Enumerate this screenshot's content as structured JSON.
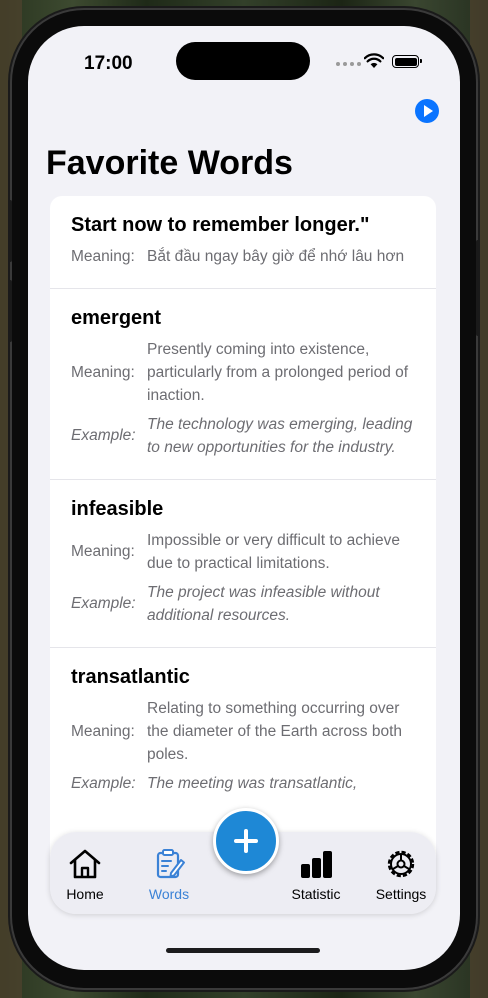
{
  "status_bar": {
    "time": "17:00"
  },
  "page": {
    "title": "Favorite Words"
  },
  "labels": {
    "meaning": "Meaning:",
    "example": "Example:"
  },
  "entries": [
    {
      "word": "Start now to remember longer.\"",
      "meaning": "Bắt đầu ngay bây giờ để nhớ lâu hơn"
    },
    {
      "word": "emergent",
      "meaning": "Presently coming into existence, particularly from a prolonged period of inaction.",
      "example": "The technology was emerging, leading to new opportunities for the industry."
    },
    {
      "word": "infeasible",
      "meaning": "Impossible or very difficult to achieve due to practical limitations.",
      "example": "The project was infeasible without additional resources."
    },
    {
      "word": "transatlantic",
      "meaning": "Relating to something occurring over the diameter of the Earth across both poles.",
      "example": "The meeting was transatlantic,"
    }
  ],
  "tabbar": {
    "home": "Home",
    "words": "Words",
    "statistic": "Statistic",
    "settings": "Settings",
    "active": "words"
  },
  "colors": {
    "accent": "#1e88d6",
    "active_tab": "#3b82d6",
    "play_button": "#0a74ff"
  },
  "icons": {
    "play": "play-circle-icon",
    "add": "plus-icon",
    "home": "house-icon",
    "words": "clipboard-pencil-icon",
    "statistic": "bar-chart-icon",
    "settings": "gear-icon"
  }
}
